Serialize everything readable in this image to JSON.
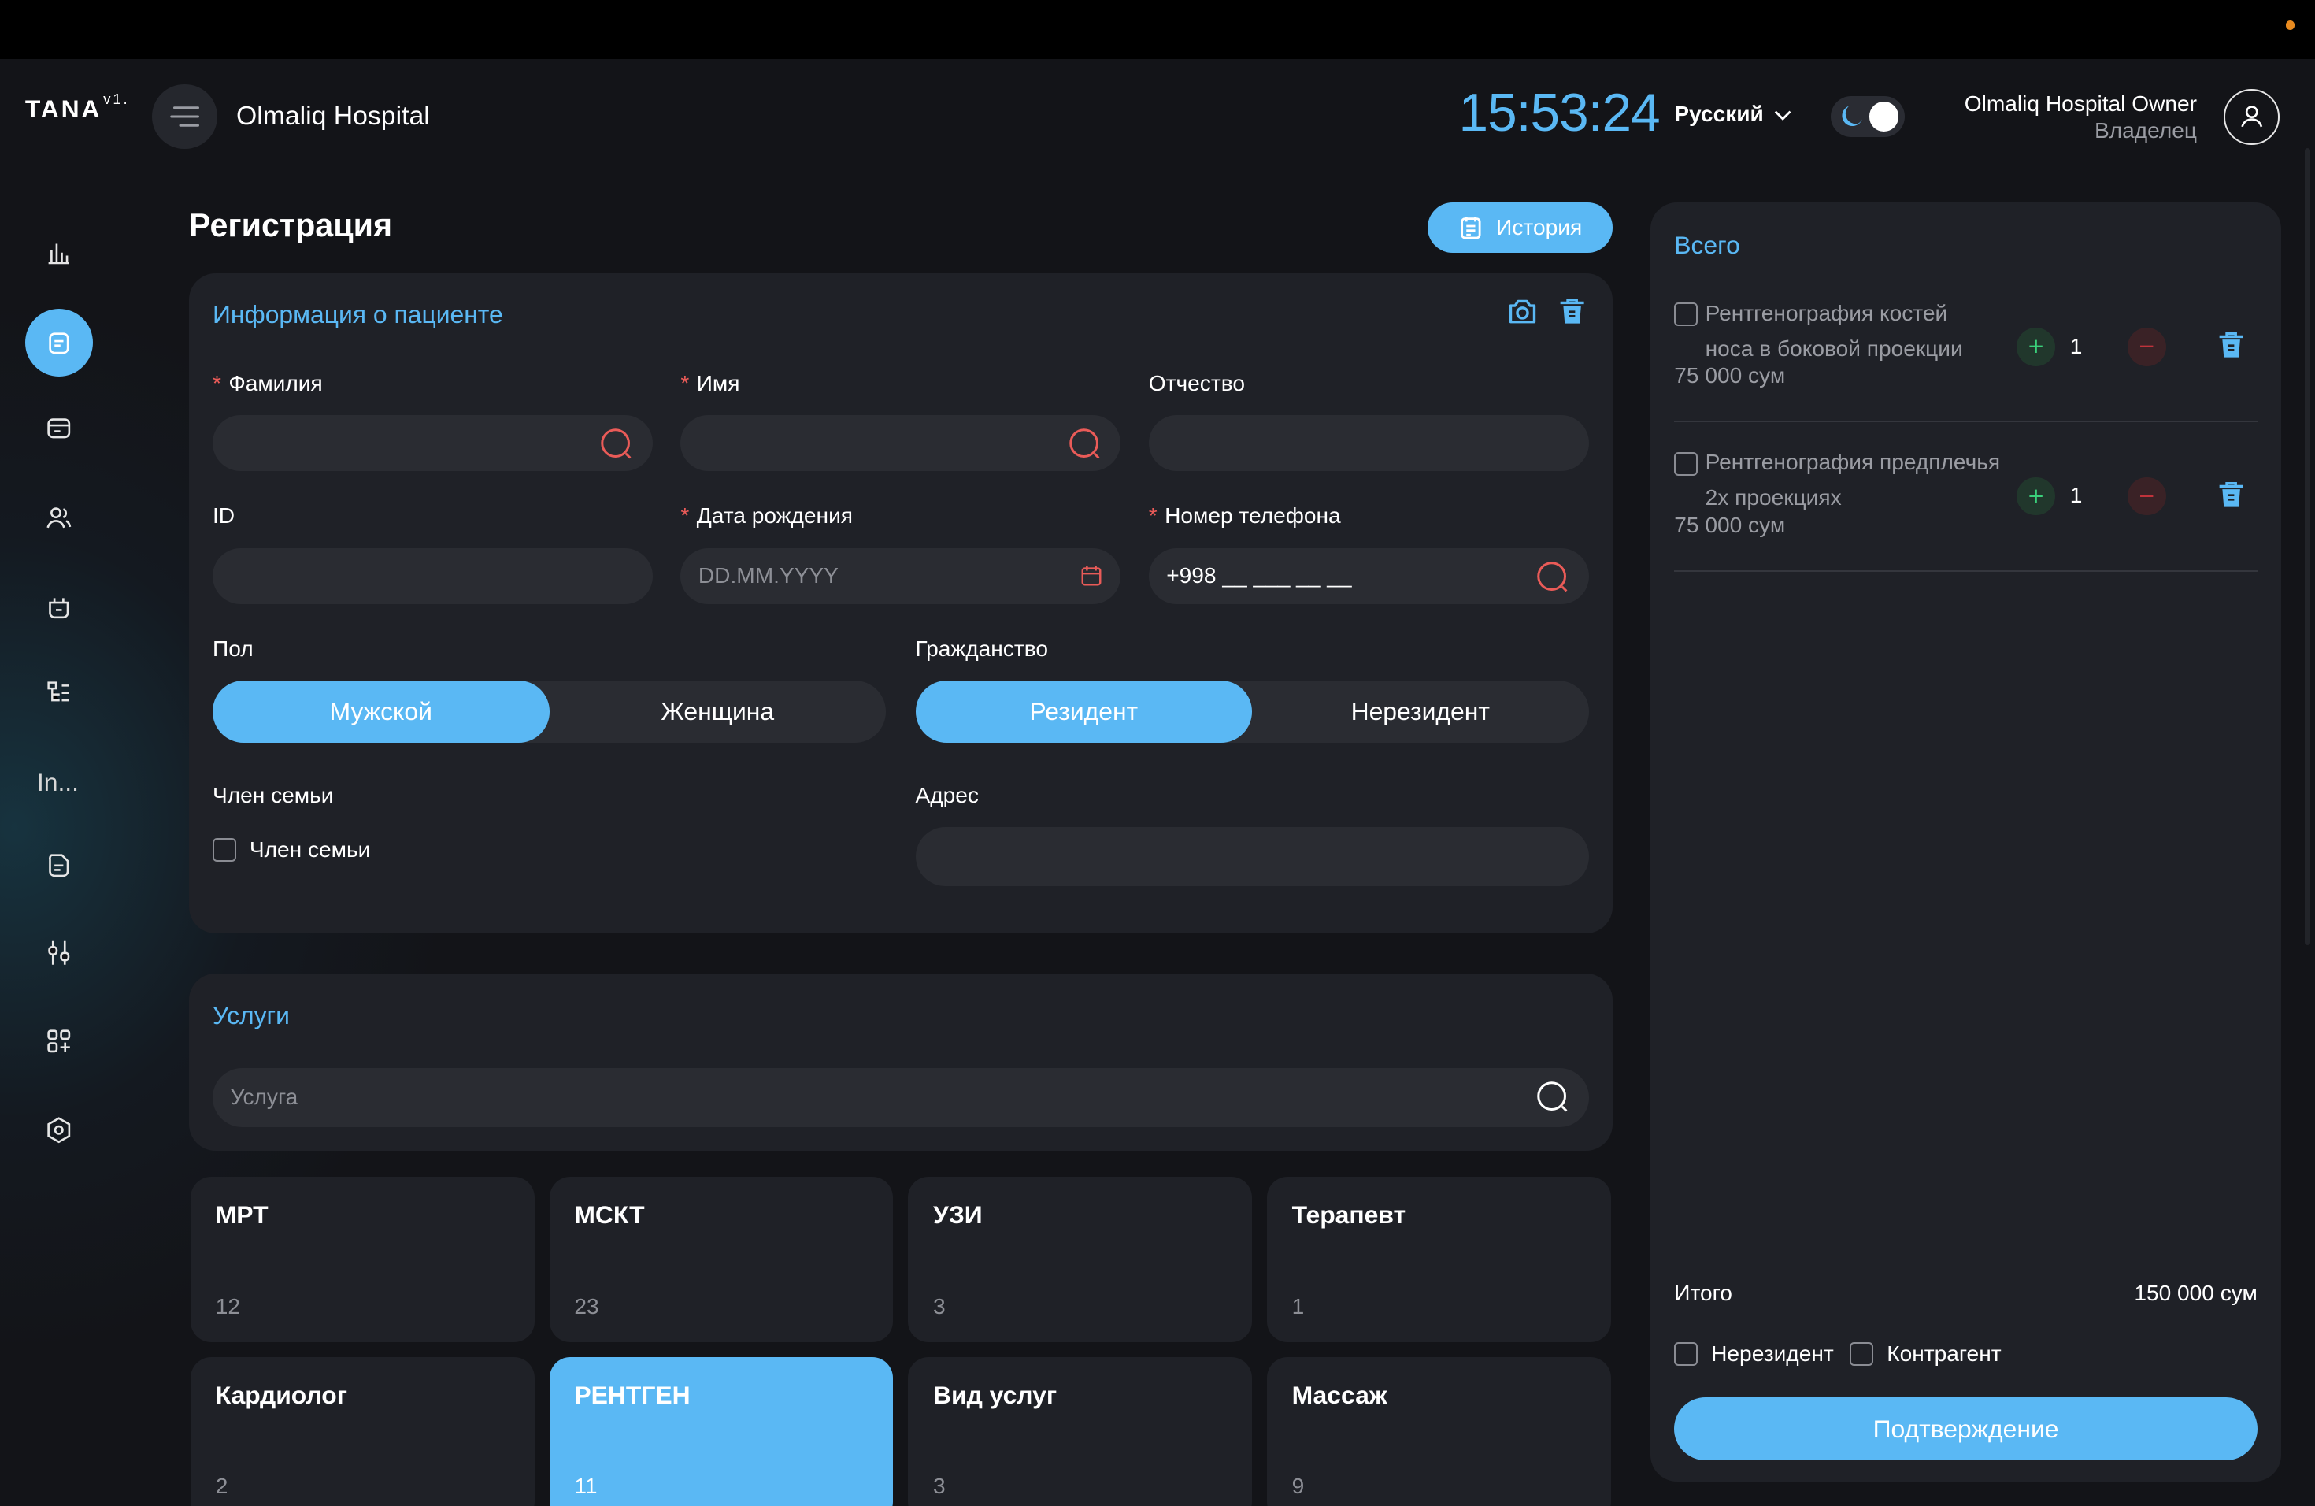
{
  "app": {
    "logo": "TANA",
    "logo_version": "v1.",
    "hospital_name": "Olmaliq Hospital"
  },
  "header": {
    "clock": "15:53:24",
    "language": "Русский",
    "user_name": "Olmaliq Hospital Owner",
    "user_role": "Владелец"
  },
  "sidebar": {
    "items": [
      "chart-icon",
      "registration-icon",
      "calendar-edit-icon",
      "users-icon",
      "doctor-bag-icon",
      "structure-icon",
      "In...",
      "document-icon",
      "settings-sliders-icon",
      "add-apps-icon",
      "hexagon-settings-icon"
    ],
    "text_item": "In..."
  },
  "page": {
    "title": "Регистрация",
    "history_label": "История"
  },
  "patient": {
    "title": "Информация о пациенте",
    "surname_label": "Фамилия",
    "name_label": "Имя",
    "patronymic_label": "Отчество",
    "id_label": "ID",
    "dob_label": "Дата рождения",
    "dob_placeholder": "DD.MM.YYYY",
    "phone_label": "Номер телефона",
    "phone_value": "+998 __ ___ __ __",
    "gender_label": "Пол",
    "gender_options": [
      "Мужской",
      "Женщина"
    ],
    "citizenship_label": "Гражданство",
    "citizenship_options": [
      "Резидент",
      "Нерезидент"
    ],
    "family_label": "Член семьи",
    "family_checkbox": "Член семьи",
    "address_label": "Адрес"
  },
  "services": {
    "title": "Услуги",
    "search_placeholder": "Услуга",
    "categories": [
      {
        "name": "МРТ",
        "count": "12"
      },
      {
        "name": "МСКТ",
        "count": "23"
      },
      {
        "name": "УЗИ",
        "count": "3"
      },
      {
        "name": "Терапевт",
        "count": "1"
      },
      {
        "name": "Кардиолог",
        "count": "2"
      },
      {
        "name": "РЕНТГЕН",
        "count": "11"
      },
      {
        "name": "Вид услуг",
        "count": "3"
      },
      {
        "name": "Массаж",
        "count": "9"
      }
    ]
  },
  "cart": {
    "title": "Всего",
    "items": [
      {
        "name_line1": "Рентгенография костей",
        "name_line2": "носа в боковой проекции",
        "price": "75 000 сум",
        "qty": "1"
      },
      {
        "name_line1": "Рентгенография предплечья",
        "name_line2": "2х проекциях",
        "price": "75 000 сум",
        "qty": "1"
      }
    ],
    "total_label": "Итого",
    "total_value": "150 000 сум",
    "nonresident_label": "Нерезидент",
    "contractor_label": "Контрагент",
    "confirm_label": "Подтверждение"
  },
  "colors": {
    "accent": "#5ab8f4",
    "required": "#ea5b58",
    "plus": "#3ad07a",
    "minus": "#c0333b"
  }
}
